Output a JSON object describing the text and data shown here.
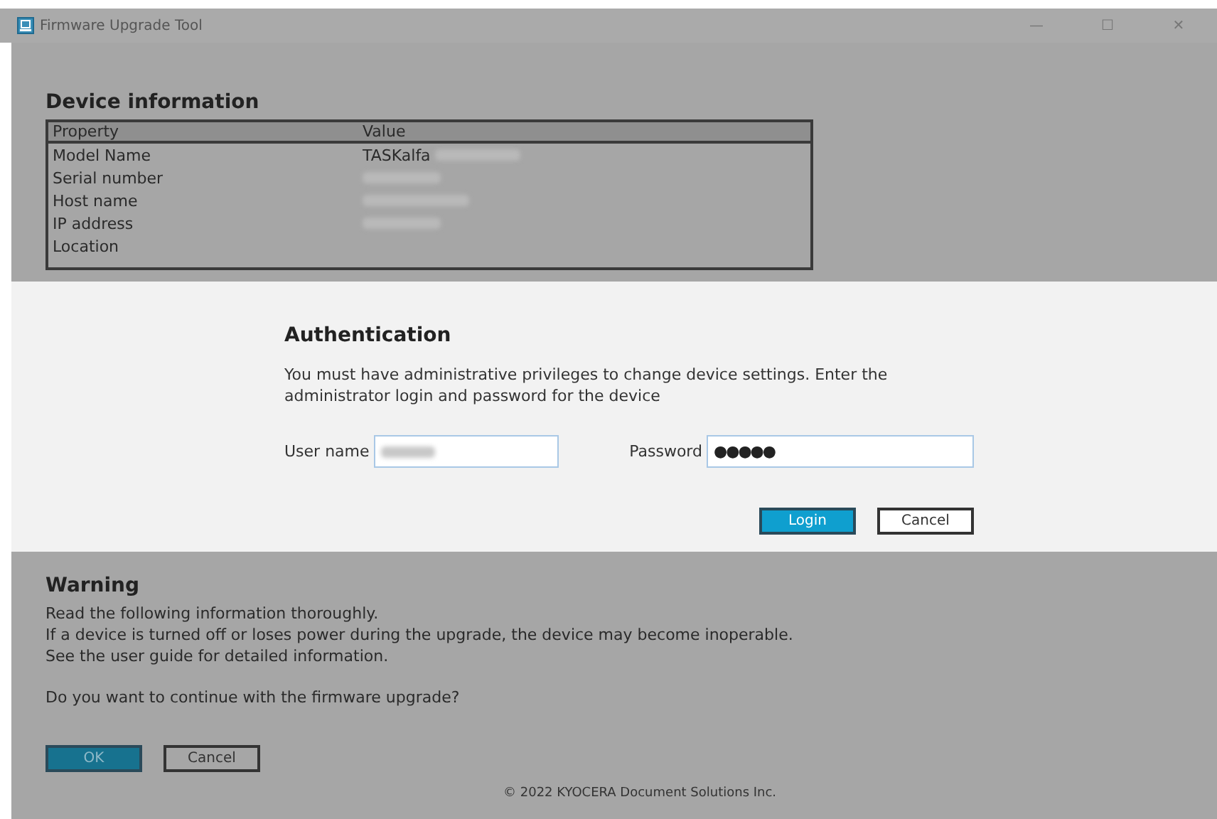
{
  "window": {
    "title": "Firmware Upgrade Tool",
    "controls": [
      "—",
      "☐",
      "✕"
    ]
  },
  "device_information": {
    "title": "Device information",
    "columns": [
      "Property",
      "Value"
    ],
    "rows": [
      {
        "property": "Model Name",
        "value": "TASKalfa",
        "redacted": true
      },
      {
        "property": "Serial number",
        "redacted": true
      },
      {
        "property": "Host name",
        "redacted": true
      },
      {
        "property": "IP address",
        "redacted": true
      },
      {
        "property": "Location",
        "redacted": false
      }
    ]
  },
  "authentication": {
    "title": "Authentication",
    "message": "You must have administrative privileges to change device settings. Enter the administrator login and password for the device",
    "user_name": {
      "label": "User name",
      "redacted": true
    },
    "password": {
      "label": "Password",
      "value": "●●●●●"
    },
    "buttons": [
      {
        "label": "Login",
        "kind": "primary"
      },
      {
        "label": "Cancel",
        "kind": "secondary"
      }
    ]
  },
  "warning": {
    "title": "Warning",
    "lines": [
      "Read the following information thoroughly.",
      "If a device is turned off or loses power during the upgrade, the device may become inoperable.",
      "See the user guide for detailed information."
    ],
    "question": "Do you want to continue with the firmware upgrade?",
    "buttons": [
      {
        "label": "OK",
        "kind": "primary"
      },
      {
        "label": "Cancel",
        "kind": "secondary"
      }
    ]
  },
  "footer": "© 2022 KYOCERA Document Solutions Inc."
}
